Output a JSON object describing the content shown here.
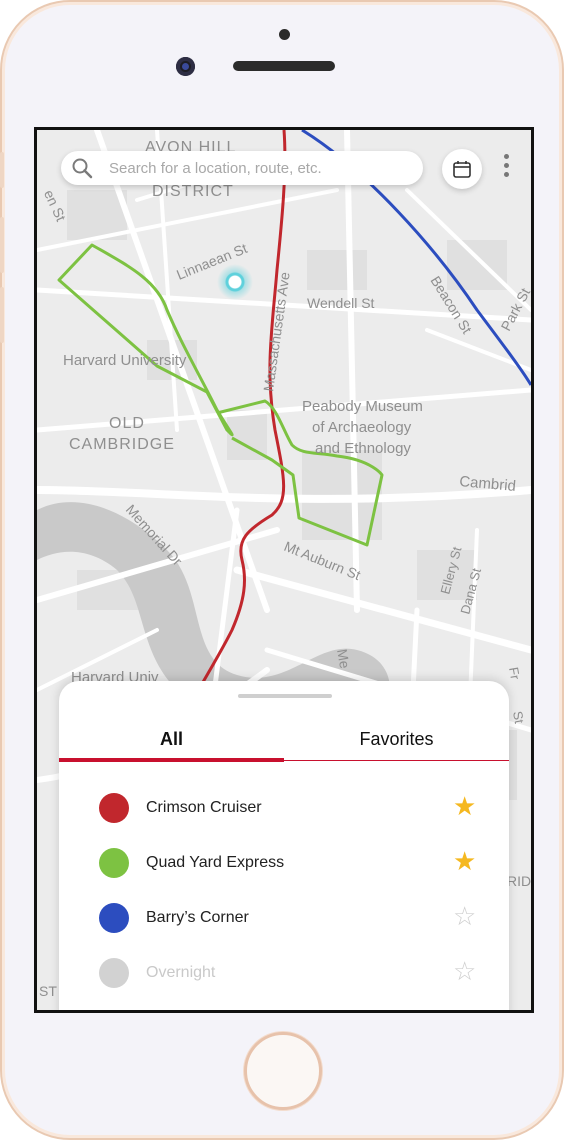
{
  "colors": {
    "crimson": "#c1272d",
    "quad_green": "#7dc242",
    "barry_blue": "#2c4dbf",
    "overnight_gray": "#cfcfcf",
    "star_gold": "#f5b820",
    "accent_red": "#c8102e"
  },
  "search": {
    "placeholder": "Search for a location, route, etc.",
    "icon": "search-icon"
  },
  "toolbar": {
    "calendar_icon": "calendar-icon",
    "more_icon": "more-vertical-icon"
  },
  "map": {
    "labels": {
      "avon_hill": "AVON HILL",
      "district": "DISTRICT",
      "en_st": "en St",
      "linnaean": "Linnaean St",
      "mass_ave": "Massachusetts Ave",
      "wendell": "Wendell St",
      "beacon": "Beacon St",
      "park": "Park St",
      "harvard_univ": "Harvard University",
      "old": "OLD",
      "cambridge": "CAMBRIDGE",
      "peabody1": "Peabody Museum",
      "peabody2": "of Archaeology",
      "peabody3": "and Ethnology",
      "cambridge_st": "Cambrid",
      "memorial": "Memorial Dr",
      "mt_auburn": "Mt Auburn St",
      "ellery": "Ellery St",
      "dana": "Dana St",
      "harvard_univ2": "Harvard Univ",
      "me": "Me",
      "rid": "RID",
      "st_edge": "ST",
      "edge_st": "St",
      "fr": "Fr"
    }
  },
  "tabs": {
    "all": "All",
    "favorites": "Favorites"
  },
  "routes": [
    {
      "name": "Crimson Cruiser",
      "favorite": true,
      "color": "#c1272d"
    },
    {
      "name": "Quad Yard Express",
      "favorite": true,
      "color": "#7dc242"
    },
    {
      "name": "Barry’s Corner",
      "favorite": false,
      "color": "#2c4dbf"
    },
    {
      "name": "Overnight",
      "favorite": false,
      "color": "#cfcfcf",
      "inactive": true
    }
  ],
  "stars": {
    "filled": "★",
    "empty": "☆"
  }
}
